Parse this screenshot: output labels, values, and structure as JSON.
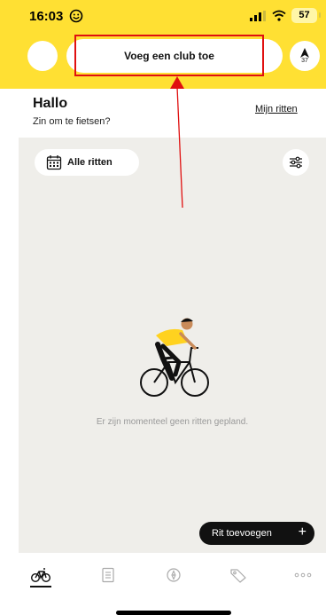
{
  "status_bar": {
    "time": "16:03",
    "battery": "57"
  },
  "header": {
    "club_button_label": "Voeg een club toe",
    "nav_distance": "37"
  },
  "greeting": {
    "title": "Hallo",
    "subtitle": "Zin om te fietsen?",
    "my_rides_link": "Mijn ritten"
  },
  "filter": {
    "label": "Alle ritten"
  },
  "empty_state": {
    "message": "Er zijn momenteel geen ritten gepland."
  },
  "add_ride": {
    "label": "Rit toevoegen",
    "plus": "+"
  },
  "tabs": [
    {
      "icon": "bike-icon",
      "active": true
    },
    {
      "icon": "news-icon",
      "active": false
    },
    {
      "icon": "compass-icon",
      "active": false
    },
    {
      "icon": "tag-icon",
      "active": false
    },
    {
      "icon": "more-icon",
      "active": false
    }
  ],
  "colors": {
    "header_yellow": "#FFE033",
    "panel_background": "#EFEEEA",
    "highlight_red": "#E01010",
    "button_dark": "#111111"
  }
}
